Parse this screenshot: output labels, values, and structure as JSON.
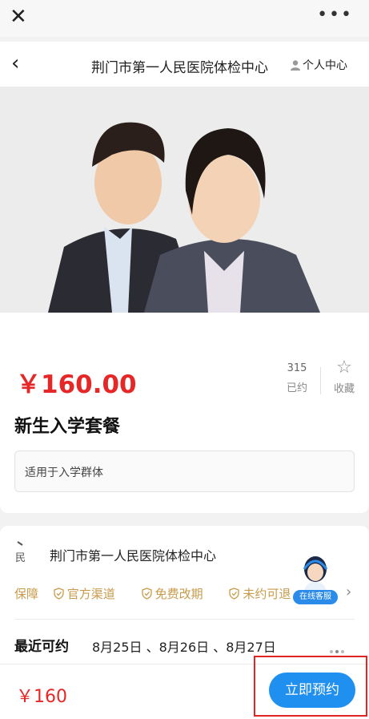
{
  "topbar": {
    "close_icon": "close-icon",
    "more_icon": "more-icon"
  },
  "navbar": {
    "title": "荆门市第一人民医院体检中心",
    "user_label": "个人中心"
  },
  "banner": {
    "alt": "people-photo"
  },
  "product": {
    "price": "￥160.00",
    "booked_count": "315",
    "booked_label": "已约",
    "favorite_label": "收藏",
    "title": "新生入学套餐",
    "description": "适用于入学群体"
  },
  "hospital": {
    "logo_text": "、 民",
    "name": "荆门市第一人民医院体检中心",
    "guarantee_label": "保障",
    "guarantees": [
      "官方渠道",
      "免费改期",
      "未约可退"
    ],
    "recent_label": "最近可约",
    "recent_dates": "8月25日 、8月26日 、8月27日"
  },
  "service": {
    "badge": "在线客服"
  },
  "bottom": {
    "price": "￥160",
    "book_button": "立即预约"
  },
  "colors": {
    "price": "#e62727",
    "accent": "#1f8ff0",
    "gold": "#c89a4b"
  }
}
